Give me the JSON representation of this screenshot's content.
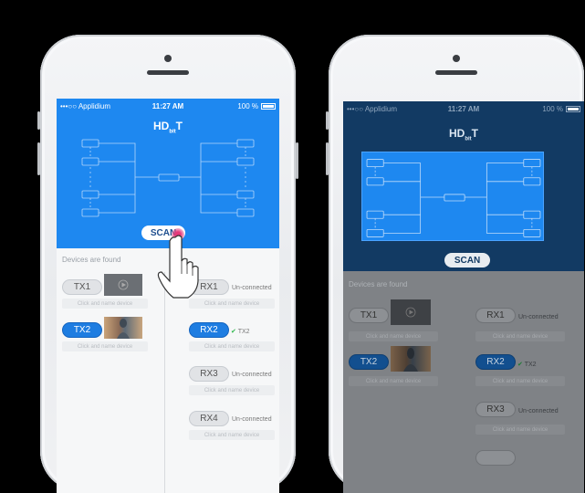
{
  "screens": [
    {
      "status": {
        "carrier": "•••○○ Applidium",
        "time": "11:27 AM",
        "battery": "100 %"
      },
      "logo": {
        "main": "HD",
        "sub": "bit",
        "end": "T"
      },
      "scan_label": "SCAN",
      "devices_title": "Devices are found",
      "tx": [
        {
          "label": "TX1",
          "hint": "Click and name device",
          "selected": false
        },
        {
          "label": "TX2",
          "hint": "Click and name device",
          "selected": true
        }
      ],
      "rx": [
        {
          "label": "RX1",
          "status": "Un-connected",
          "hint": "Click and name device",
          "selected": false
        },
        {
          "label": "RX2",
          "status": "TX2",
          "hint": "Click and name device",
          "selected": true
        },
        {
          "label": "RX3",
          "status": "Un-connected",
          "hint": "Click and name device",
          "selected": false
        },
        {
          "label": "RX4",
          "status": "Un-connected",
          "hint": "Click and name device",
          "selected": false
        }
      ]
    },
    {
      "status": {
        "carrier": "•••○○ Applidium",
        "time": "11:27 AM",
        "battery": "100 %"
      },
      "logo": {
        "main": "HD",
        "sub": "bit",
        "end": "T"
      },
      "scan_label": "SCAN",
      "devices_title": "Devices are found",
      "tx": [
        {
          "label": "TX1",
          "hint": "Click and name device",
          "selected": false
        },
        {
          "label": "TX2",
          "hint": "Click and name device",
          "selected": true
        }
      ],
      "rx": [
        {
          "label": "RX1",
          "status": "Un-connected",
          "hint": "Click and name device",
          "selected": false
        },
        {
          "label": "RX2",
          "status": "TX2",
          "hint": "Click and name device",
          "selected": true
        },
        {
          "label": "RX3",
          "status": "Un-connected",
          "hint": "Click and name device",
          "selected": false
        }
      ]
    }
  ],
  "colors": {
    "header_blue": "#1e88f0",
    "header_dark": "#123a63",
    "accent": "#1e7de1",
    "ok_green": "#2eb84b",
    "touch": "#e5397a"
  }
}
